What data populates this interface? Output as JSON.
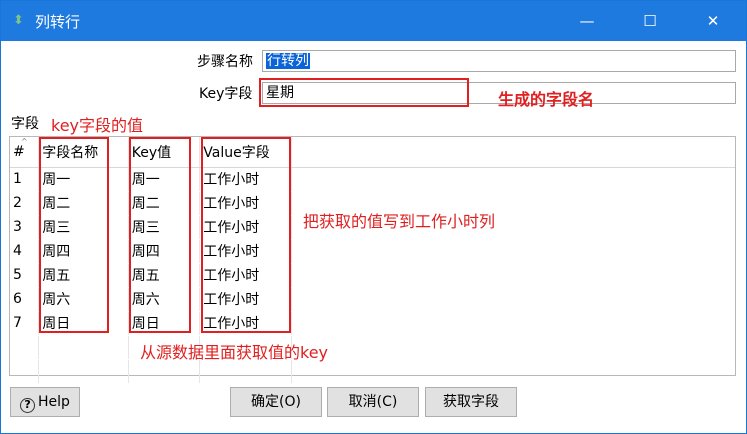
{
  "window": {
    "title": "列转行"
  },
  "controls": {
    "minimize": "—",
    "maximize": "☐",
    "close": "✕"
  },
  "form": {
    "step_name_label": "步骤名称",
    "step_name_value": "行转列",
    "key_field_label": "Key字段",
    "key_field_value": "星期"
  },
  "annotations": {
    "generated_field_name": "生成的字段名",
    "key_field_value": "key字段的值",
    "write_to_hours": "把获取的值写到工作小时列",
    "key_from_source": "从源数据里面获取值的key"
  },
  "table": {
    "section_label": "字段",
    "headers": {
      "index": "#",
      "field_name": "字段名称",
      "key_value": "Key值",
      "value_field": "Value字段"
    },
    "rows": [
      {
        "index": "1",
        "field_name": "周一",
        "key_value": "周一",
        "value_field": "工作小时"
      },
      {
        "index": "2",
        "field_name": "周二",
        "key_value": "周二",
        "value_field": "工作小时"
      },
      {
        "index": "3",
        "field_name": "周三",
        "key_value": "周三",
        "value_field": "工作小时"
      },
      {
        "index": "4",
        "field_name": "周四",
        "key_value": "周四",
        "value_field": "工作小时"
      },
      {
        "index": "5",
        "field_name": "周五",
        "key_value": "周五",
        "value_field": "工作小时"
      },
      {
        "index": "6",
        "field_name": "周六",
        "key_value": "周六",
        "value_field": "工作小时"
      },
      {
        "index": "7",
        "field_name": "周日",
        "key_value": "周日",
        "value_field": "工作小时"
      }
    ]
  },
  "buttons": {
    "help": "Help",
    "ok": "确定(O)",
    "cancel": "取消(C)",
    "get_fields": "获取字段"
  },
  "colors": {
    "titlebar": "#1f7ae0",
    "annotation": "#e02020",
    "selection": "#0a64d8"
  }
}
